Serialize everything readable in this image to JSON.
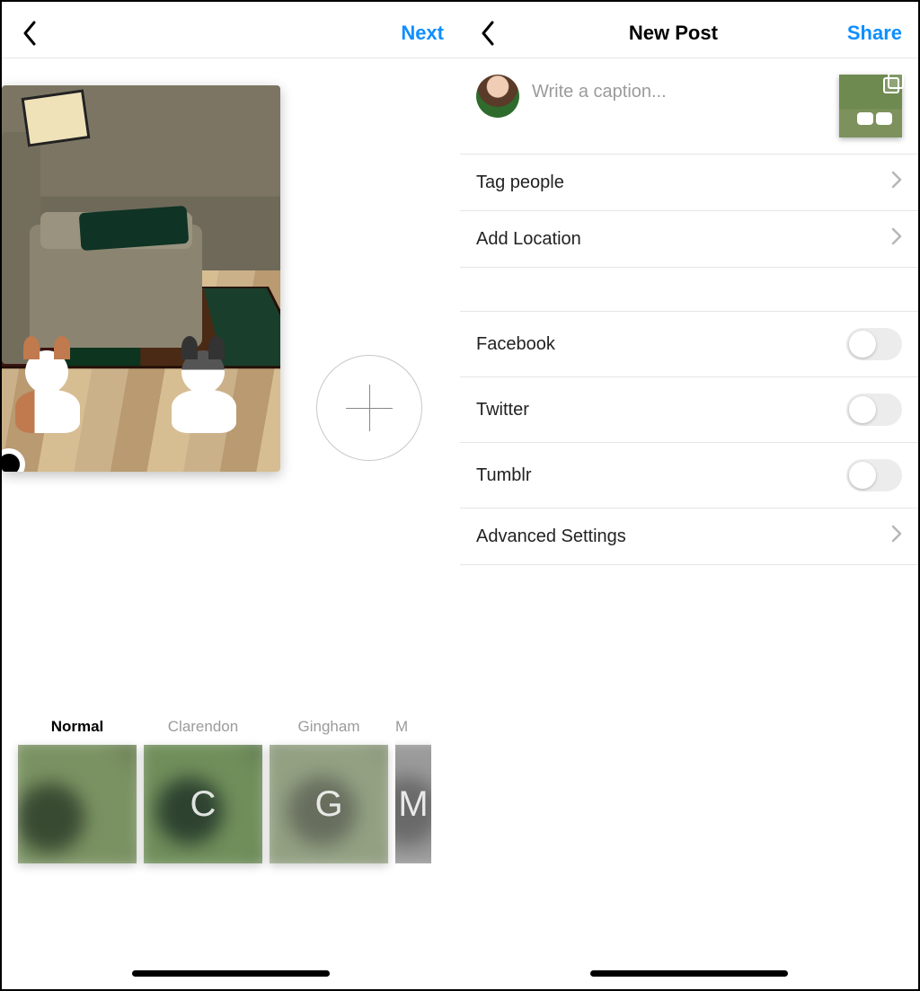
{
  "left_screen": {
    "header": {
      "next_label": "Next"
    },
    "add_button_label": "Add",
    "filters": [
      {
        "name": "Normal",
        "letter": "",
        "selected": true
      },
      {
        "name": "Clarendon",
        "letter": "C",
        "selected": false
      },
      {
        "name": "Gingham",
        "letter": "G",
        "selected": false
      },
      {
        "name": "Moon",
        "letter": "M",
        "selected": false,
        "cut": true,
        "visible_label": "M"
      }
    ]
  },
  "right_screen": {
    "header": {
      "title": "New Post",
      "share_label": "Share"
    },
    "caption_placeholder": "Write a caption...",
    "rows": {
      "tag_people": "Tag people",
      "add_location": "Add Location",
      "advanced": "Advanced Settings"
    },
    "share_targets": [
      {
        "name": "Facebook",
        "on": false
      },
      {
        "name": "Twitter",
        "on": false
      },
      {
        "name": "Tumblr",
        "on": false
      }
    ]
  }
}
